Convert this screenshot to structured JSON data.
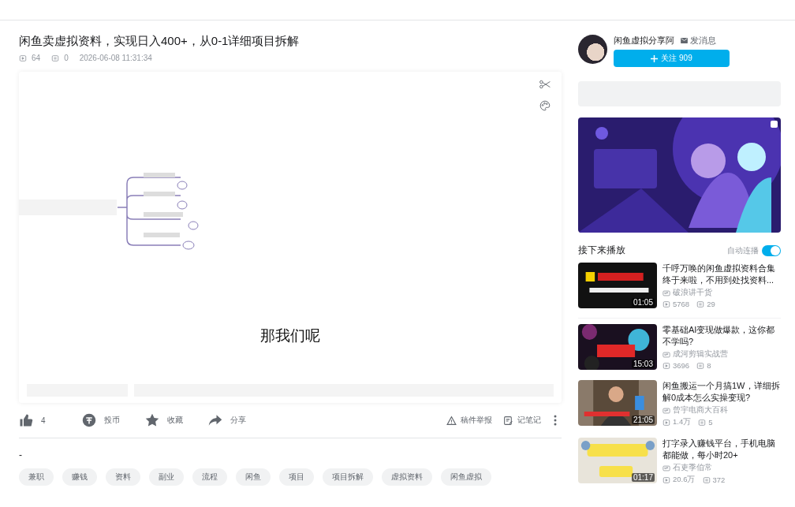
{
  "video": {
    "title": "闲鱼卖虚拟资料，实现日入400+，从0-1详细项目拆解",
    "views": "64",
    "danmaku": "0",
    "date": "2026-06-08 11:31:34",
    "subtitle": "那我们呢"
  },
  "actions": [
    {
      "kind": "like",
      "label": "4"
    },
    {
      "kind": "coin",
      "label": "投币"
    },
    {
      "kind": "favorite",
      "label": "收藏"
    },
    {
      "kind": "share",
      "label": "分享"
    }
  ],
  "tools": [
    {
      "kind": "report",
      "label": "稿件举报"
    },
    {
      "kind": "note",
      "label": "记笔记"
    }
  ],
  "description": "-",
  "tags": [
    "兼职",
    "赚钱",
    "资料",
    "副业",
    "流程",
    "闲鱼",
    "项目",
    "项目拆解",
    "虚拟资料",
    "闲鱼虚拟"
  ],
  "uploader": {
    "name": "闲鱼虚拟分享阿",
    "message": "发消息",
    "follow": "关注 909"
  },
  "up_next": {
    "title": "接下来播放",
    "autoplay_label": "自动连播",
    "autoplay_on": true
  },
  "recommendations": [
    {
      "title": "千呼万唤的闲鱼虚拟资料合集终于来啦，不用到处找资料...",
      "uploader": "破浪讲干货",
      "views": "5768",
      "comments": "29",
      "duration": "01:05"
    },
    {
      "title": "零基础AI变现做爆款，这你都不学吗?",
      "uploader": "成河剪辑实战营",
      "views": "3696",
      "comments": "8",
      "duration": "15:03"
    },
    {
      "title": "闲鱼搬运一个月搞1W，详细拆解0成本怎么实操变现?",
      "uploader": "曾宇电商大百科",
      "views": "1.4万",
      "comments": "5",
      "duration": "21:05"
    },
    {
      "title": "打字录入赚钱平台，手机电脑都能做，每小时20+",
      "uploader": "石吏季伯常",
      "views": "20.6万",
      "comments": "372",
      "duration": "01:17"
    }
  ]
}
